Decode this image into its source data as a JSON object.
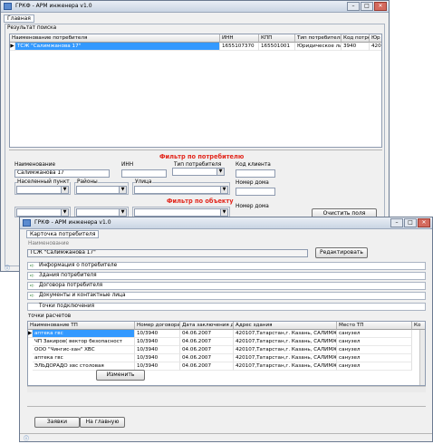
{
  "back_window": {
    "title": "ГРКФ - АРМ инженера v1.0",
    "tab_main": "Главная",
    "results_label": "Результат поиска",
    "columns": [
      "Наименование потребителя",
      "ИНН",
      "КПП",
      "Тип потребителя",
      "Код потребит",
      "Юр"
    ],
    "row": {
      "name": "ТСЖ \"Салимжанова 17\"",
      "inn": "1655107370",
      "kpp": "165501001",
      "type": "Юридическое лицо",
      "code": "3940",
      "extra": "420"
    },
    "filter_consumer_title": "Фильтр по потребителю",
    "filter_object_title": "Фильтр по объекту",
    "label_name": "Наименование",
    "label_inn": "ИНН",
    "label_type": "Тип потребителя",
    "label_code": "Код клиента",
    "name_value": "Салимжанова 17",
    "label_city": "Населенный пункт",
    "label_district": "Районы",
    "label_street": "Улица",
    "label_house": "Номер дома",
    "label_house2": "Номер дома",
    "clear_button": "Очистить поля"
  },
  "front_window": {
    "title": "ГРКФ - АРМ инженера v1.0",
    "card_label": "Карточка потребителя",
    "name_label": "Наименование",
    "name_value": "ТСЖ \"Салимжанова 17\"",
    "edit_button": "Редактировать",
    "sections": [
      "Информация о потребителе",
      "Здания потребителя",
      "Договора потребителя",
      "Документы и контактные лица",
      "Точки подключения"
    ],
    "points_label": "точки расчетов",
    "columns": [
      "Наименование ТП",
      "Номер договора",
      "Дата заключения до",
      "Адрес здания",
      "Место ТП",
      "Ко"
    ],
    "rows": [
      [
        "аптека гвс",
        "10/3940",
        "04.06.2007",
        "420107,Татарстан,г. Казань, САЛИМЖАНОВ",
        "санузел"
      ],
      [
        "ЧП Закиров( вектор безопасност",
        "10/3940",
        "04.06.2007",
        "420107,Татарстан,г. Казань, САЛИМЖАНОВ",
        "санузел"
      ],
      [
        "ООО \"Чингис-хан\" ХВС",
        "10/3940",
        "04.06.2007",
        "420107,Татарстан,г. Казань, САЛИМЖАНОВ",
        "санузел"
      ],
      [
        "аптека гвс",
        "10/3940",
        "04.06.2007",
        "420107,Татарстан,г. Казань, САЛИМЖАНОВ",
        "санузел"
      ],
      [
        "ЭЛЬДОРАДО хвс столовая",
        "10/3940",
        "04.06.2007",
        "420107,Татарстан,г. Казань, САЛИМЖАНОВ",
        "санузел"
      ]
    ],
    "change_button": "Изменить",
    "requests_button": "Заявки",
    "home_button": "На главную"
  }
}
